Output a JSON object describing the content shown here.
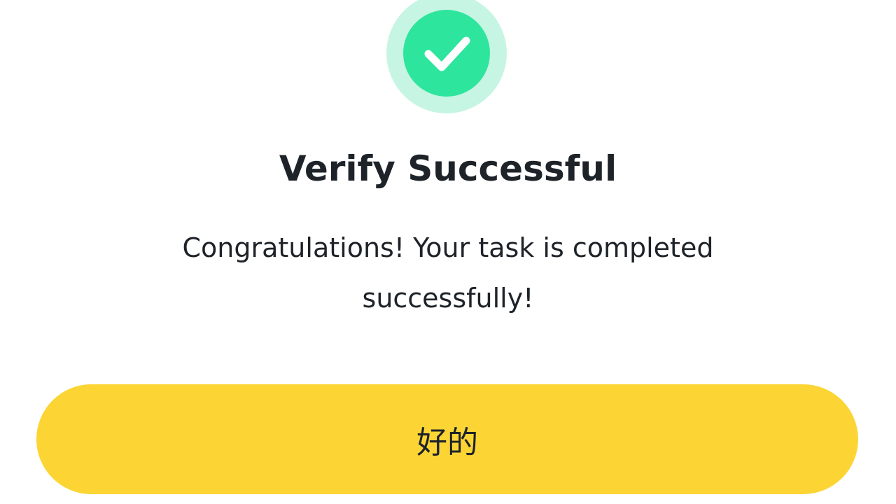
{
  "dialog": {
    "icon": "check-icon",
    "title": "Verify Successful",
    "message": "Congratulations! Your task is completed successfully!",
    "confirm_label": "好的"
  },
  "colors": {
    "badge_outer": "#c7f5e3",
    "badge_inner": "#2ee59d",
    "button": "#fcd535",
    "text": "#1e2329"
  }
}
